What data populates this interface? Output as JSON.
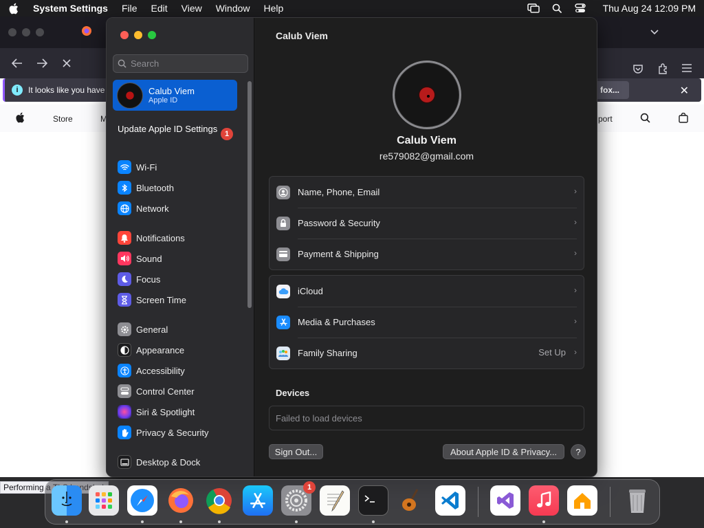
{
  "menubar": {
    "app_name": "System Settings",
    "items": [
      "File",
      "Edit",
      "View",
      "Window",
      "Help"
    ],
    "clock": "Thu Aug 24  12:09 PM"
  },
  "browser": {
    "notice_text": "It looks like you have",
    "notice_button": "fox...",
    "store_nav": {
      "store": "Store",
      "m": "M",
      "support": "port"
    },
    "status_text": "Performing a TLS handshake"
  },
  "sidebar": {
    "search_placeholder": "Search",
    "account": {
      "name": "Calub Viem",
      "subtitle": "Apple ID"
    },
    "update": {
      "label": "Update Apple ID Settings",
      "badge": "1"
    },
    "items": [
      {
        "label": "Wi-Fi",
        "icon": "wifi-icon",
        "color": "#0a84ff"
      },
      {
        "label": "Bluetooth",
        "icon": "bluetooth-icon",
        "color": "#0a84ff"
      },
      {
        "label": "Network",
        "icon": "globe-icon",
        "color": "#0a84ff"
      },
      {
        "label": "Notifications",
        "icon": "bell-icon",
        "color": "#ff453a"
      },
      {
        "label": "Sound",
        "icon": "speaker-icon",
        "color": "#ff375f"
      },
      {
        "label": "Focus",
        "icon": "moon-icon",
        "color": "#5e5ce6"
      },
      {
        "label": "Screen Time",
        "icon": "hourglass-icon",
        "color": "#5e5ce6"
      },
      {
        "label": "General",
        "icon": "gear-icon",
        "color": "#8e8e93"
      },
      {
        "label": "Appearance",
        "icon": "appearance-icon",
        "color": "#1c1c1e"
      },
      {
        "label": "Accessibility",
        "icon": "accessibility-icon",
        "color": "#0a84ff"
      },
      {
        "label": "Control Center",
        "icon": "control-center-icon",
        "color": "#8e8e93"
      },
      {
        "label": "Siri & Spotlight",
        "icon": "siri-icon",
        "color": "#bf5af2"
      },
      {
        "label": "Privacy & Security",
        "icon": "hand-icon",
        "color": "#0a84ff"
      },
      {
        "label": "Desktop & Dock",
        "icon": "dock-icon",
        "color": "#1c1c1e"
      }
    ]
  },
  "main": {
    "window_title": "Calub Viem",
    "user_name": "Calub Viem",
    "user_email": "re579082@gmail.com",
    "group1": [
      {
        "label": "Name, Phone, Email",
        "icon": "person-icon"
      },
      {
        "label": "Password & Security",
        "icon": "lock-icon"
      },
      {
        "label": "Payment & Shipping",
        "icon": "card-icon"
      }
    ],
    "group2": [
      {
        "label": "iCloud",
        "icon": "icloud-icon",
        "value": ""
      },
      {
        "label": "Media & Purchases",
        "icon": "app-store-icon",
        "value": ""
      },
      {
        "label": "Family Sharing",
        "icon": "family-icon",
        "value": "Set Up"
      }
    ],
    "devices_title": "Devices",
    "devices_status": "Failed to load devices",
    "sign_out": "Sign Out...",
    "about": "About Apple ID & Privacy...",
    "help": "?"
  },
  "dock": {
    "settings_badge": "1"
  }
}
